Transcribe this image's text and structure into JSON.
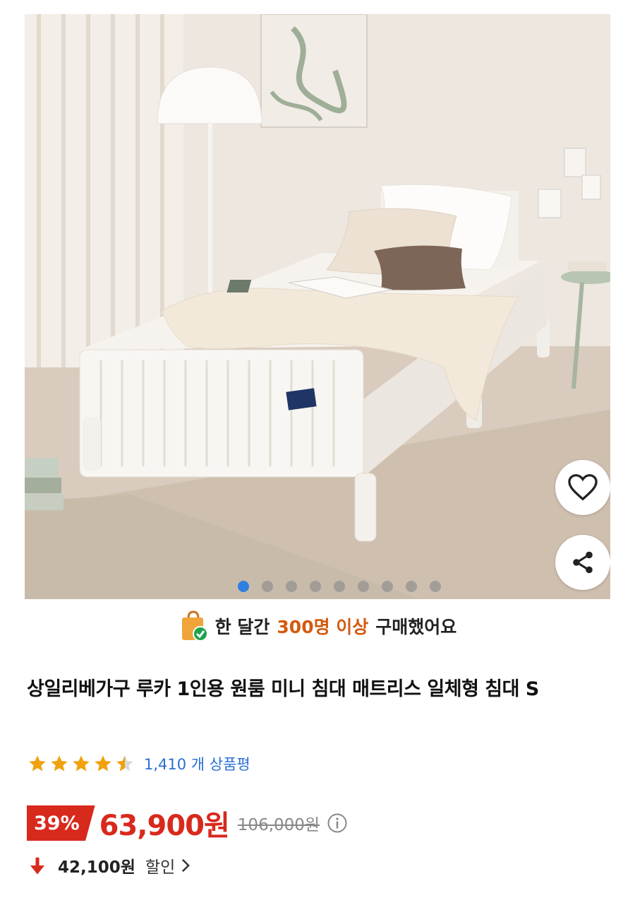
{
  "gallery": {
    "image_alt": "Bed in bright bedroom",
    "total_images": 9,
    "active_index": 0
  },
  "social_proof": {
    "prefix": "한 달간",
    "highlight": "300명 이상",
    "suffix": "구매했어요",
    "highlight_color": "#d4590f"
  },
  "product": {
    "title": "상일리베가구 루카 1인용 원룸 미니 침대 매트리스 일체형 침대 S",
    "rating": 4.5,
    "review_count_label": "1,410 개 상품평"
  },
  "pricing": {
    "discount_percent": "39%",
    "sale_price": "63,900원",
    "original_price": "106,000원",
    "discount_amount": "42,100원",
    "discount_label": "할인",
    "accent_color": "#d8291d"
  },
  "icons": {
    "heart": "heart-icon",
    "share": "share-icon",
    "info": "info-icon",
    "arrow": "arrow-down-icon",
    "chevron": "chevron-right-icon",
    "bag": "shopping-bag-check-icon"
  }
}
